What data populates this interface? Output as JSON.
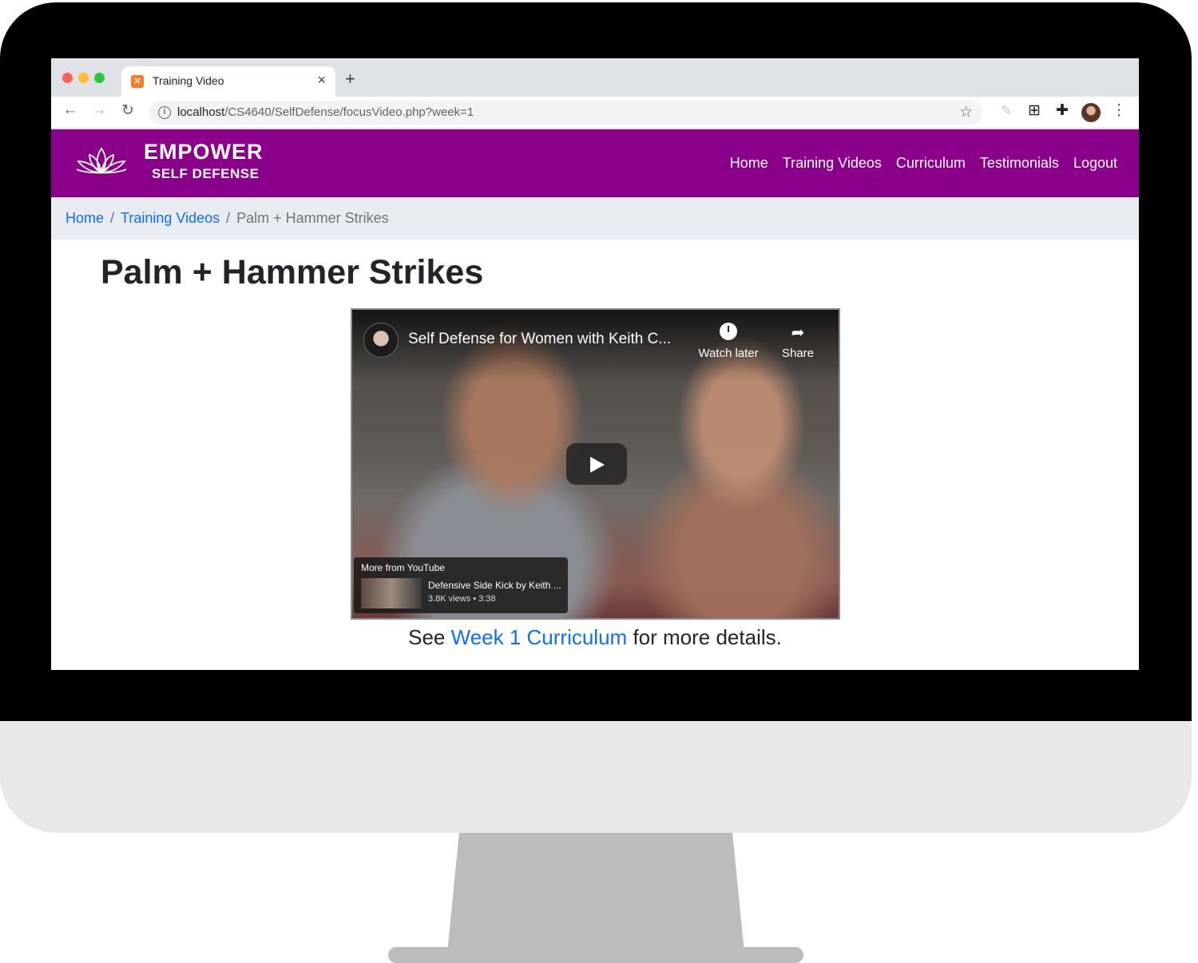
{
  "browser": {
    "tab_title": "Training Video",
    "tab_favicon": "xampp-icon",
    "tab_close": "×",
    "new_tab": "+",
    "url_host": "localhost",
    "url_path": "/CS4640/SelfDefense/focusVideo.php?week=1",
    "icons": [
      "back-icon",
      "forward-icon",
      "reload-icon",
      "info-icon",
      "star-icon",
      "feather-icon",
      "grid-icon",
      "puzzle-icon",
      "profile-avatar",
      "menu-icon"
    ]
  },
  "site": {
    "brand_top": "EMPOWER",
    "brand_bottom": "SELF DEFENSE",
    "brand_color": "#8b008b",
    "nav": [
      "Home",
      "Training Videos",
      "Curriculum",
      "Testimonials",
      "Logout"
    ]
  },
  "breadcrumb": {
    "home": "Home",
    "training": "Training Videos",
    "current": "Palm + Hammer Strikes",
    "separator": "/"
  },
  "page": {
    "title": "Palm + Hammer Strikes",
    "footnote_before": "See ",
    "footnote_link": "Week 1 Curriculum",
    "footnote_after": " for more details.",
    "link_color": "#0d6efd"
  },
  "video": {
    "title": "Self Defense for Women with Keith C...",
    "watch_later": "Watch later",
    "share": "Share",
    "more_from": "More from YouTube",
    "more_title": "Defensive Side Kick by Keith ...",
    "more_meta": "3.8K views • 3:38"
  }
}
